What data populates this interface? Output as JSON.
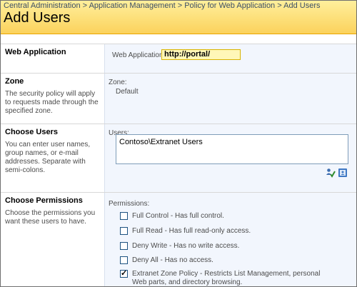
{
  "breadcrumb": {
    "items": [
      "Central Administration",
      "Application Management",
      "Policy for Web Application",
      "Add Users"
    ],
    "separator": ">"
  },
  "page_title": "Add Users",
  "sections": {
    "web_application": {
      "heading": "Web Application",
      "field_label": "Web Application:",
      "value": "http://portal/"
    },
    "zone": {
      "heading": "Zone",
      "description": "The security policy will apply to requests made through the specified zone.",
      "field_label": "Zone:",
      "value": "Default"
    },
    "choose_users": {
      "heading": "Choose Users",
      "description": "You can enter user names, group names, or e-mail addresses. Separate with semi-colons.",
      "field_label": "Users:",
      "value": "Contoso\\Extranet Users",
      "icons": [
        "check-names-icon",
        "browse-address-book-icon"
      ]
    },
    "choose_permissions": {
      "heading": "Choose Permissions",
      "description": "Choose the permissions you want these users to have.",
      "field_label": "Permissions:",
      "options": [
        {
          "label": "Full Control - Has full control.",
          "checked": false
        },
        {
          "label": "Full Read - Has full read-only access.",
          "checked": false
        },
        {
          "label": "Deny Write - Has no write access.",
          "checked": false
        },
        {
          "label": "Deny All - Has no access.",
          "checked": false
        },
        {
          "label": "Extranet Zone Policy - Restricts List Management, personal Web parts, and directory browsing.",
          "checked": true
        }
      ]
    }
  },
  "colors": {
    "header_top": "#ffef9c",
    "header_bottom": "#fbd25c",
    "section_right_bg": "#f2f6fd",
    "webapp_box_bg": "#fff7b8"
  }
}
